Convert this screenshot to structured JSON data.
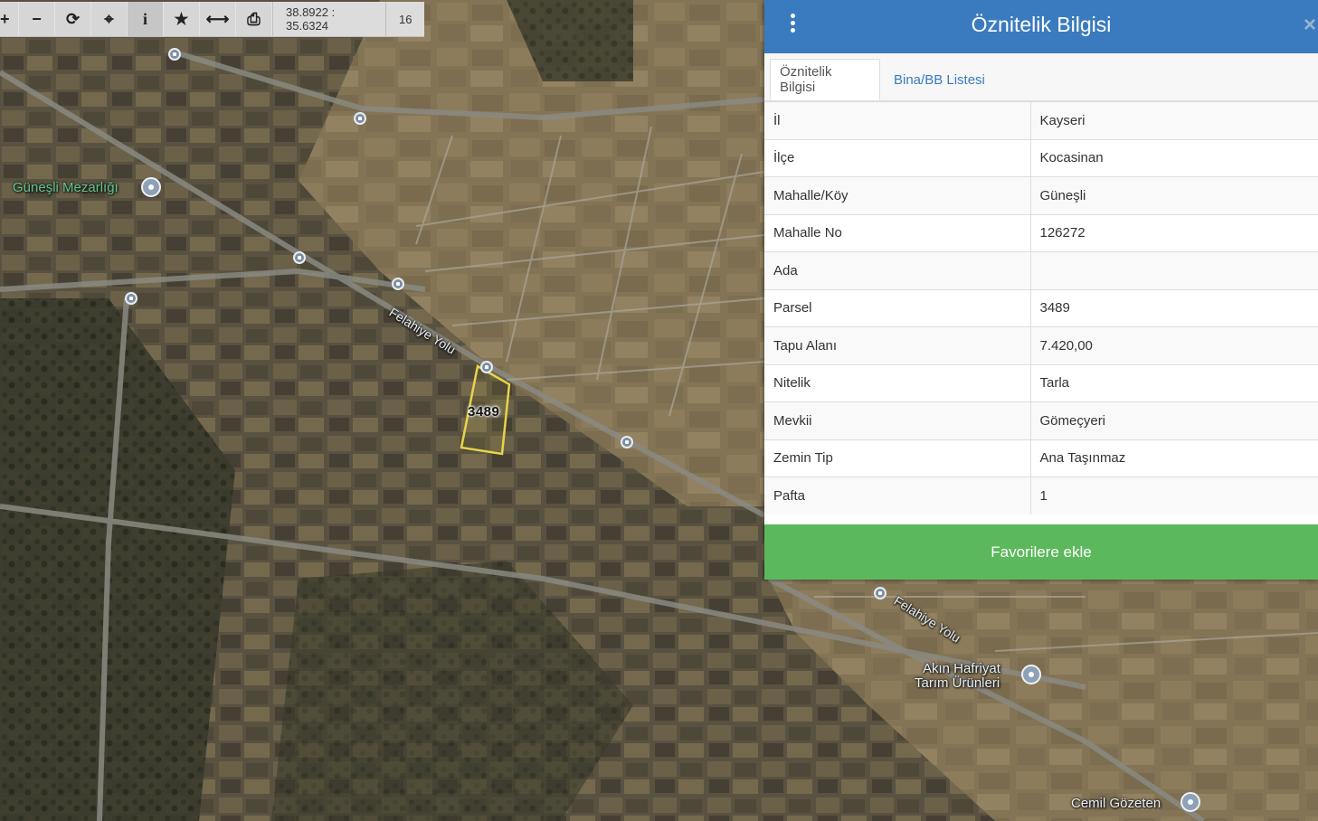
{
  "toolbar": {
    "zoom_in_icon": "+",
    "zoom_out_icon": "−",
    "refresh_icon": "⟳",
    "locate_icon": "⌖",
    "info_icon": "i",
    "star_icon": "★",
    "measure_icon": "⟷",
    "print_icon": "⎙",
    "coordinates": "38.8922 : 35.6324",
    "zoom_level": "16"
  },
  "map": {
    "labels": {
      "cemetery": "Güneşli Mezarlığı",
      "road1": "Felahiye Yolu",
      "road2": "Felahiye Yolu",
      "poi1_line1": "Akın Hafriyat",
      "poi1_line2": "Tarım Ürünleri",
      "poi2": "Cemil Gözeten"
    },
    "parcel_number": "3489"
  },
  "panel": {
    "title": "Öznitelik Bilgisi",
    "close": "×",
    "tabs": [
      {
        "label": "Öznitelik Bilgisi"
      },
      {
        "label": "Bina/BB Listesi"
      }
    ],
    "rows": [
      {
        "key": "İl",
        "value": "Kayseri"
      },
      {
        "key": "İlçe",
        "value": "Kocasinan"
      },
      {
        "key": "Mahalle/Köy",
        "value": "Güneşli"
      },
      {
        "key": "Mahalle No",
        "value": "126272"
      },
      {
        "key": "Ada",
        "value": ""
      },
      {
        "key": "Parsel",
        "value": "3489"
      },
      {
        "key": "Tapu Alanı",
        "value": "7.420,00"
      },
      {
        "key": "Nitelik",
        "value": "Tarla"
      },
      {
        "key": "Mevkii",
        "value": "Gömeçyeri"
      },
      {
        "key": "Zemin Tip",
        "value": "Ana Taşınmaz"
      },
      {
        "key": "Pafta",
        "value": "1"
      }
    ],
    "favorite_button": "Favorilere ekle"
  },
  "colors": {
    "header_blue": "#3a7bbf",
    "button_green": "#5cb85c",
    "parcel_outline": "#e6d44a"
  }
}
